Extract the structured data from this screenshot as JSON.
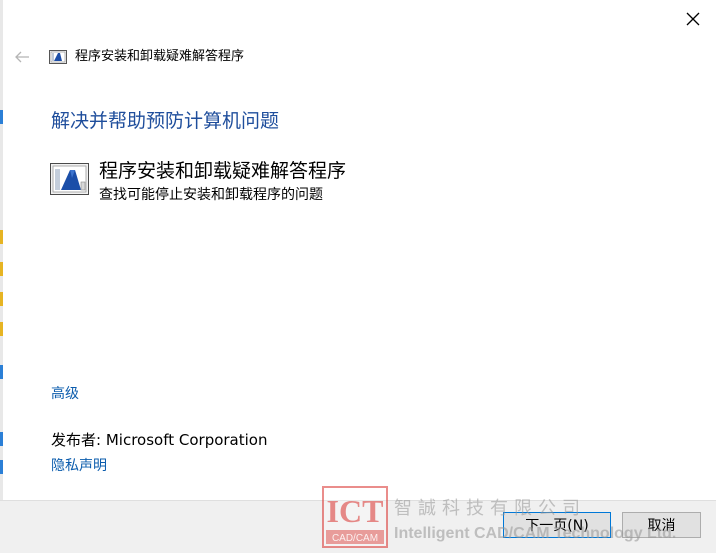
{
  "window": {
    "title": "程序安装和卸载疑难解答程序"
  },
  "main": {
    "heading": "解决并帮助预防计算机问题",
    "item": {
      "title": "程序安装和卸载疑难解答程序",
      "description": "查找可能停止安装和卸载程序的问题"
    },
    "advanced_link": "高级",
    "publisher_label": "发布者:",
    "publisher_name": "Microsoft Corporation",
    "privacy_link": "隐私声明"
  },
  "footer": {
    "next_label": "下一页(N)",
    "cancel_label": "取消"
  },
  "watermark": {
    "logo_text": "ICT",
    "logo_sub": "CAD/CAM",
    "chinese": "智誠科技有限公司",
    "english": "Intelligent CAD/CAM Technology Ltd."
  },
  "colors": {
    "heading": "#1f4e9c",
    "link": "#0b5cad",
    "accent": "#0078d7",
    "watermark_red": "#d9302c"
  },
  "icons": {
    "close": "close-icon",
    "back": "back-arrow-icon",
    "troubleshooter": "troubleshooter-icon"
  }
}
